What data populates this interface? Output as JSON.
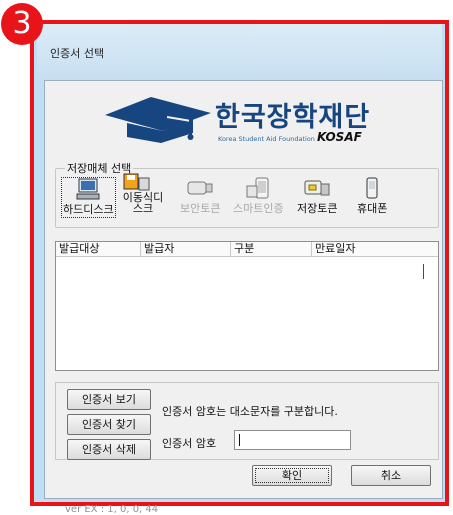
{
  "step_number": "3",
  "dialog": {
    "title": "인증서 선택"
  },
  "banner": {
    "korean_name": "한국장학재단",
    "english_name": "Korea Student Aid Foundation",
    "abbreviation": "KOSAF"
  },
  "storage": {
    "label": "저장매체 선택",
    "items": [
      {
        "label": "하드디스크",
        "icon": "hard-disk-icon",
        "enabled": true,
        "selected": true
      },
      {
        "label": "이동식디스크",
        "icon": "removable-disk-icon",
        "enabled": true
      },
      {
        "label": "보안토큰",
        "icon": "security-token-icon",
        "enabled": false
      },
      {
        "label": "스마트인증",
        "icon": "smart-cert-icon",
        "enabled": false
      },
      {
        "label": "저장토큰",
        "icon": "storage-token-icon",
        "enabled": true
      },
      {
        "label": "휴대폰",
        "icon": "mobile-phone-icon",
        "enabled": true
      }
    ]
  },
  "table": {
    "columns": [
      "발급대상",
      "발급자",
      "구분",
      "만료일자"
    ],
    "rows": []
  },
  "actions": {
    "view": "인증서 보기",
    "find": "인증서 찾기",
    "delete": "인증서 삭제"
  },
  "hint": "인증서 암호는 대소문자를 구분합니다.",
  "password": {
    "label": "인증서 암호",
    "value": ""
  },
  "buttons": {
    "ok": "확인",
    "cancel": "취소"
  },
  "version": "ver EX : 1, 0, 0, 44",
  "colors": {
    "highlight_border": "#e8141a",
    "brand_blue": "#17457f"
  }
}
